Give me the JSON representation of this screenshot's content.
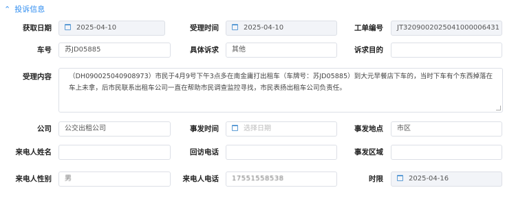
{
  "section": {
    "title": "投诉信息",
    "icon": "chevron-up-icon"
  },
  "labels": {
    "acquire_date": "获取日期",
    "accept_time": "受理时间",
    "ticket_no": "工单编号",
    "car_no": "车号",
    "specific_appeal": "具体诉求",
    "appeal_purpose": "诉求目的",
    "content": "受理内容",
    "company": "公司",
    "incident_time": "事发时间",
    "incident_place": "事发地点",
    "caller_name": "来电人姓名",
    "callback_phone": "回访电话",
    "incident_area": "事发区域",
    "caller_gender": "来电人性别",
    "caller_phone": "来电人电话",
    "deadline": "时限"
  },
  "values": {
    "acquire_date": "2025-04-10",
    "accept_time": "2025-04-10",
    "ticket_no": "JT3209002025041000006431",
    "car_no": "苏JD05885",
    "specific_appeal": "其他",
    "appeal_purpose": "",
    "content": "（DH090025040908973）市民于4月9号下午3点多在南金庸打出租车（车牌号：苏JD05885）到大元早餐店下车的，当时下车有个东西掉落在车上未拿，后市民联系出租车公司一直在帮助市民调查监控寻找，市民表扬出租车公司负责任。",
    "company": "公交出租公司",
    "incident_time_placeholder": "选择日期",
    "incident_place": "市区",
    "caller_name": "",
    "callback_phone": "",
    "incident_area": "",
    "caller_gender": "男",
    "caller_phone": "17551558538",
    "deadline": "2025-04-16"
  },
  "colors": {
    "accent": "#2d8cf0",
    "disabled_bg": "#f2f4f8",
    "border": "#dcdfe6"
  }
}
